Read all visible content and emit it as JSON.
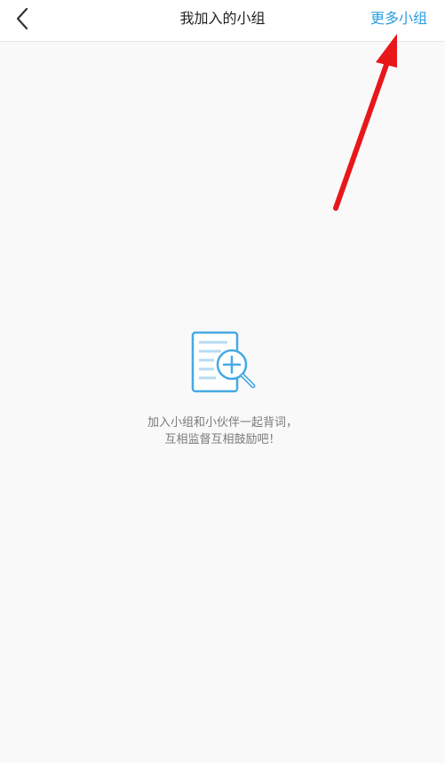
{
  "navbar": {
    "back_icon": "chevron-left-icon",
    "title": "我加入的小组",
    "more_label": "更多小组",
    "accent_color": "#2e9ee2"
  },
  "empty_state": {
    "icon": "document-search-plus-icon",
    "line1": "加入小组和小伙伴一起背词，",
    "line2": "互相监督互相鼓励吧！"
  },
  "annotation": {
    "icon": "red-arrow-pointing-to-more-groups",
    "color": "#e8171a"
  }
}
